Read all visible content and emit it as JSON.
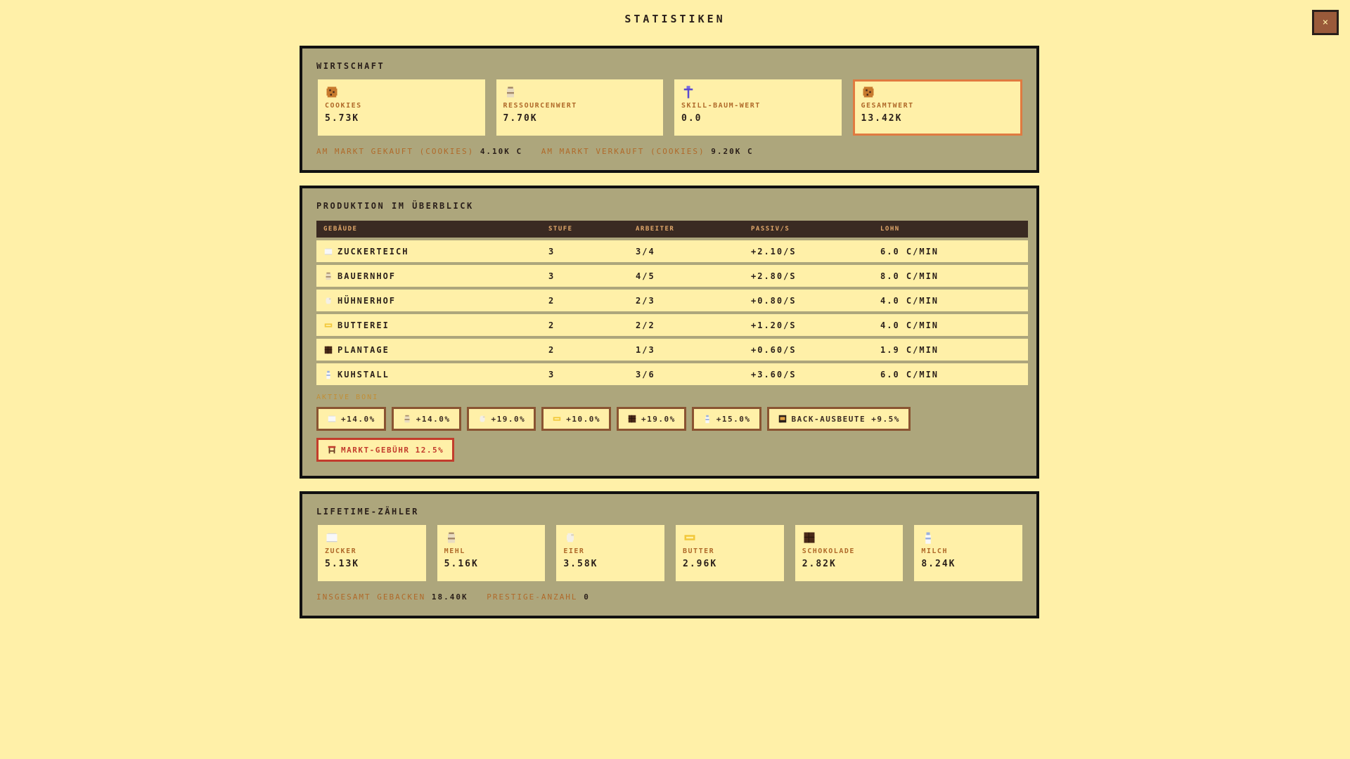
{
  "title": "STATISTIKEN",
  "close_label": "×",
  "economy": {
    "title": "WIRTSCHAFT",
    "cards": [
      {
        "icon": "cookie-icon",
        "label": "COOKIES",
        "value": "5.73K"
      },
      {
        "icon": "flour-sack-icon",
        "label": "RESSOURCENWERT",
        "value": "7.70K"
      },
      {
        "icon": "skill-tree-icon",
        "label": "SKILL-BAUM-WERT",
        "value": "0.0"
      },
      {
        "icon": "cookie-icon",
        "label": "GESAMTWERT",
        "value": "13.42K"
      }
    ],
    "bought_label": "AM MARKT GEKAUFT (COOKIES)",
    "bought_value": "4.10K C",
    "sold_label": "AM MARKT VERKAUFT (COOKIES)",
    "sold_value": "9.20K C"
  },
  "production": {
    "title": "PRODUKTION IM ÜBERBLICK",
    "columns": [
      "GEBÄUDE",
      "STUFE",
      "ARBEITER",
      "PASSIV/S",
      "LOHN"
    ],
    "rows": [
      {
        "icon": "sugar-icon",
        "name": "ZUCKERTEICH",
        "stufe": "3",
        "arbeiter": "3/4",
        "passiv": "+2.10/S",
        "lohn": "6.0 C/MIN"
      },
      {
        "icon": "flour-sack-icon",
        "name": "BAUERNHOF",
        "stufe": "3",
        "arbeiter": "4/5",
        "passiv": "+2.80/S",
        "lohn": "8.0 C/MIN"
      },
      {
        "icon": "egg-icon",
        "name": "HÜHNERHOF",
        "stufe": "2",
        "arbeiter": "2/3",
        "passiv": "+0.80/S",
        "lohn": "4.0 C/MIN"
      },
      {
        "icon": "butter-icon",
        "name": "BUTTEREI",
        "stufe": "2",
        "arbeiter": "2/2",
        "passiv": "+1.20/S",
        "lohn": "4.0 C/MIN"
      },
      {
        "icon": "chocolate-icon",
        "name": "PLANTAGE",
        "stufe": "2",
        "arbeiter": "1/3",
        "passiv": "+0.60/S",
        "lohn": "1.9 C/MIN"
      },
      {
        "icon": "milk-icon",
        "name": "KUHSTALL",
        "stufe": "3",
        "arbeiter": "3/6",
        "passiv": "+3.60/S",
        "lohn": "6.0 C/MIN"
      }
    ],
    "boni_label": "AKTIVE BONI",
    "boni": [
      {
        "icon": "sugar-icon",
        "text": "+14.0%"
      },
      {
        "icon": "flour-sack-icon",
        "text": "+14.0%"
      },
      {
        "icon": "egg-icon",
        "text": "+19.0%"
      },
      {
        "icon": "butter-icon",
        "text": "+10.0%"
      },
      {
        "icon": "chocolate-icon",
        "text": "+19.0%"
      },
      {
        "icon": "milk-icon",
        "text": "+15.0%"
      },
      {
        "icon": "oven-icon",
        "text": "BACK-AUSBEUTE +9.5%"
      }
    ],
    "fee": {
      "icon": "market-stall-icon",
      "text": "MARKT-GEBÜHR 12.5%"
    }
  },
  "lifetime": {
    "title": "LIFETIME-ZÄHLER",
    "cards": [
      {
        "icon": "sugar-icon",
        "label": "ZUCKER",
        "value": "5.13K"
      },
      {
        "icon": "flour-sack-icon",
        "label": "MEHL",
        "value": "5.16K"
      },
      {
        "icon": "egg-icon",
        "label": "EIER",
        "value": "3.58K"
      },
      {
        "icon": "butter-icon",
        "label": "BUTTER",
        "value": "2.96K"
      },
      {
        "icon": "chocolate-icon",
        "label": "SCHOKOLADE",
        "value": "2.82K"
      },
      {
        "icon": "milk-icon",
        "label": "MILCH",
        "value": "8.24K"
      }
    ],
    "baked_label": "INSGESAMT GEBACKEN",
    "baked_value": "18.40K",
    "prestige_label": "PRESTIGE-ANZAHL",
    "prestige_value": "0"
  }
}
